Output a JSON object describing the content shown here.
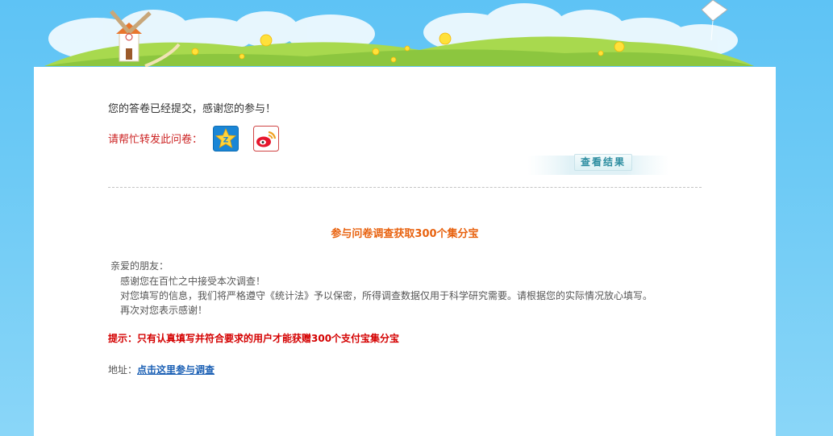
{
  "banner": {
    "sky_color": "#5ec3f5",
    "grass_color": "#9ed34a"
  },
  "submission": {
    "message": "您的答卷已经提交，感谢您的参与！"
  },
  "share": {
    "label": "请帮忙转发此问卷：",
    "icons": [
      "qzone-icon",
      "weibo-icon"
    ]
  },
  "results_button": {
    "label": "查看结果"
  },
  "promo": {
    "title": "参与问卷调查获取300个集分宝",
    "greeting": "亲爱的朋友：",
    "lines": [
      "感谢您在百忙之中接受本次调查！",
      "对您填写的信息，我们将严格遵守《统计法》予以保密，所得调查数据仅用于科学研究需要。请根据您的实际情况放心填写。",
      "再次对您表示感谢！"
    ],
    "tip": "提示：只有认真填写并符合要求的用户才能获赠300个支付宝集分宝",
    "address_label": "地址：",
    "address_link": "点击这里参与调查"
  },
  "colors": {
    "title_orange": "#e8620f",
    "tip_red": "#d40000",
    "share_red": "#cc2222",
    "link_blue": "#1a5fb4"
  }
}
